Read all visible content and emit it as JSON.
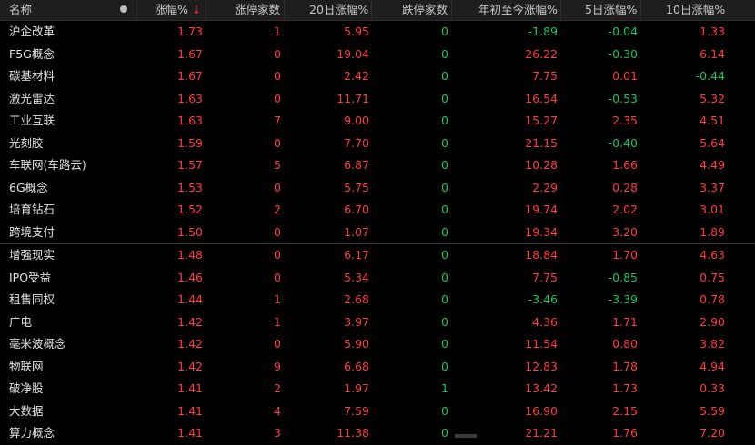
{
  "header": {
    "name": "名称",
    "change_pct": "涨幅%",
    "sort_arrow": "↓",
    "limit_up_count": "涨停家数",
    "chg_20d": "20日涨幅%",
    "limit_down_count": "跌停家数",
    "ytd": "年初至今涨幅%",
    "chg_5d": "5日涨幅%",
    "chg_10d": "10日涨幅%"
  },
  "rows": [
    {
      "name": "沪企改革",
      "chg": "1.73",
      "up": "1",
      "d20": "5.95",
      "down": "0",
      "ytd": "-1.89",
      "d5": "-0.04",
      "d10": "1.33"
    },
    {
      "name": "F5G概念",
      "chg": "1.67",
      "up": "0",
      "d20": "19.04",
      "down": "0",
      "ytd": "26.22",
      "d5": "-0.30",
      "d10": "6.14"
    },
    {
      "name": "碳基材料",
      "chg": "1.67",
      "up": "0",
      "d20": "2.42",
      "down": "0",
      "ytd": "7.75",
      "d5": "0.01",
      "d10": "-0.44"
    },
    {
      "name": "激光雷达",
      "chg": "1.63",
      "up": "0",
      "d20": "11.71",
      "down": "0",
      "ytd": "16.54",
      "d5": "-0.53",
      "d10": "5.32"
    },
    {
      "name": "工业互联",
      "chg": "1.63",
      "up": "7",
      "d20": "9.00",
      "down": "0",
      "ytd": "15.27",
      "d5": "2.35",
      "d10": "4.51"
    },
    {
      "name": "光刻胶",
      "chg": "1.59",
      "up": "0",
      "d20": "7.70",
      "down": "0",
      "ytd": "21.15",
      "d5": "-0.40",
      "d10": "5.64"
    },
    {
      "name": "车联网(车路云)",
      "chg": "1.57",
      "up": "5",
      "d20": "6.87",
      "down": "0",
      "ytd": "10.28",
      "d5": "1.66",
      "d10": "4.49"
    },
    {
      "name": "6G概念",
      "chg": "1.53",
      "up": "0",
      "d20": "5.75",
      "down": "0",
      "ytd": "2.29",
      "d5": "0.28",
      "d10": "3.37"
    },
    {
      "name": "培育钻石",
      "chg": "1.52",
      "up": "2",
      "d20": "6.70",
      "down": "0",
      "ytd": "19.74",
      "d5": "2.02",
      "d10": "3.01"
    },
    {
      "name": "跨境支付",
      "chg": "1.50",
      "up": "0",
      "d20": "1.07",
      "down": "0",
      "ytd": "19.34",
      "d5": "3.20",
      "d10": "1.89"
    },
    {
      "name": "增强现实",
      "chg": "1.48",
      "up": "0",
      "d20": "6.17",
      "down": "0",
      "ytd": "18.84",
      "d5": "1.70",
      "d10": "4.63"
    },
    {
      "name": "IPO受益",
      "chg": "1.46",
      "up": "0",
      "d20": "5.34",
      "down": "0",
      "ytd": "7.75",
      "d5": "-0.85",
      "d10": "0.75"
    },
    {
      "name": "租售同权",
      "chg": "1.44",
      "up": "1",
      "d20": "2.68",
      "down": "0",
      "ytd": "-3.46",
      "d5": "-3.39",
      "d10": "0.78"
    },
    {
      "name": "广电",
      "chg": "1.42",
      "up": "1",
      "d20": "3.97",
      "down": "0",
      "ytd": "4.36",
      "d5": "1.71",
      "d10": "2.90"
    },
    {
      "name": "毫米波概念",
      "chg": "1.42",
      "up": "0",
      "d20": "5.90",
      "down": "0",
      "ytd": "11.54",
      "d5": "0.80",
      "d10": "3.82"
    },
    {
      "name": "物联网",
      "chg": "1.42",
      "up": "9",
      "d20": "6.68",
      "down": "0",
      "ytd": "12.83",
      "d5": "1.78",
      "d10": "4.94"
    },
    {
      "name": "破净股",
      "chg": "1.41",
      "up": "2",
      "d20": "1.97",
      "down": "1",
      "ytd": "13.42",
      "d5": "1.73",
      "d10": "0.33"
    },
    {
      "name": "大数据",
      "chg": "1.41",
      "up": "4",
      "d20": "7.59",
      "down": "0",
      "ytd": "16.90",
      "d5": "2.15",
      "d10": "5.59"
    },
    {
      "name": "算力概念",
      "chg": "1.41",
      "up": "3",
      "d20": "11.38",
      "down": "0",
      "ytd": "21.21",
      "d5": "1.76",
      "d10": "7.20"
    }
  ],
  "colors": {
    "up": "#ff3b3b",
    "down": "#19c45a",
    "neutral": "#d7d7d7",
    "background": "#000000",
    "header_bg": "#1e1e1e"
  }
}
